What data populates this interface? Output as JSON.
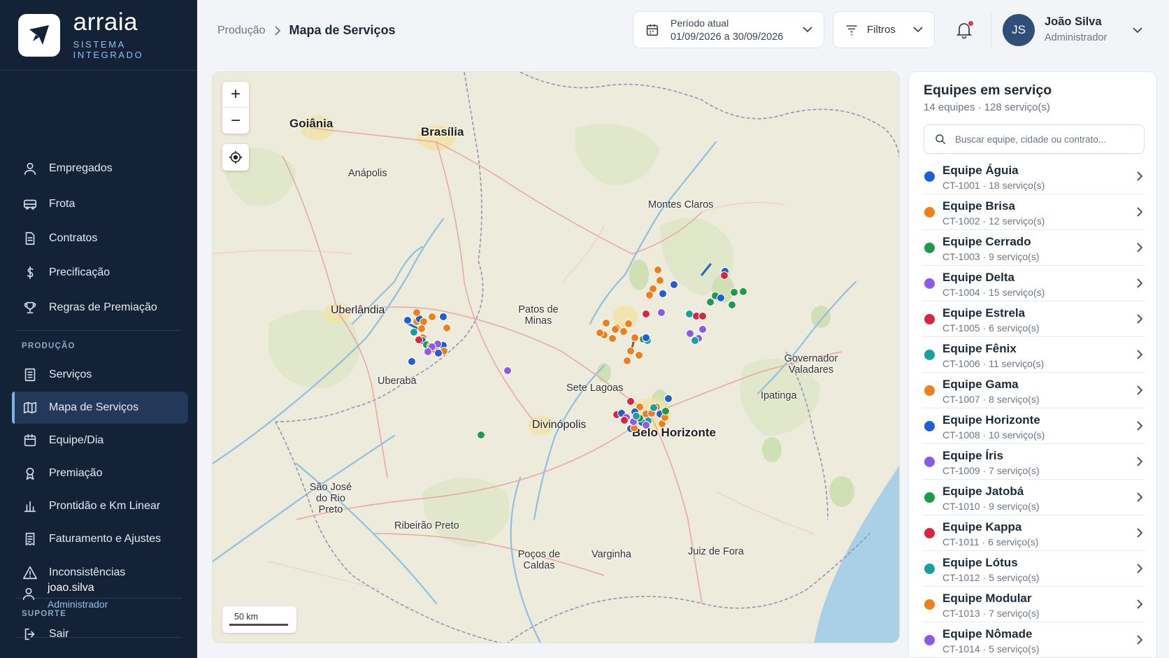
{
  "brand": {
    "name": "arraia",
    "subtitle": "SISTEMA INTEGRADO"
  },
  "sidebar": {
    "items": [
      {
        "label": "Empregados",
        "icon": "user-icon"
      },
      {
        "label": "Frota",
        "icon": "truck-icon"
      },
      {
        "label": "Contratos",
        "icon": "document-icon"
      },
      {
        "label": "Precificação",
        "icon": "dollar-icon"
      },
      {
        "label": "Regras de Premiação",
        "icon": "trophy-icon"
      }
    ],
    "producao_label": "PRODUÇÃO",
    "producao_items": [
      {
        "label": "Serviços",
        "icon": "list-icon"
      },
      {
        "label": "Mapa de Serviços",
        "icon": "map-icon",
        "active": true
      },
      {
        "label": "Equipe/Dia",
        "icon": "calendar-icon"
      },
      {
        "label": "Premiação",
        "icon": "award-icon"
      },
      {
        "label": "Prontidão e Km Linear",
        "icon": "bar-chart-icon"
      },
      {
        "label": "Faturamento e Ajustes",
        "icon": "receipt-icon"
      },
      {
        "label": "Inconsistências",
        "icon": "warning-icon"
      }
    ],
    "suporte_label": "SUPORTE",
    "user": {
      "name": "joao.silva",
      "role": "Administrador"
    },
    "logout_label": "Sair"
  },
  "header": {
    "breadcrumb_parent": "Produção",
    "breadcrumb_current": "Mapa de Serviços",
    "period_label": "Período atual",
    "period_value": "01/09/2026 a 30/09/2026",
    "filters_label": "Filtros",
    "user_initials": "JS",
    "user_name": "João Silva",
    "user_role": "Administrador"
  },
  "map": {
    "zoom_in": "+",
    "zoom_out": "−",
    "scale_label": "50 km",
    "cities": [
      {
        "name": "Goiânia",
        "big": true
      },
      {
        "name": "Brasília",
        "big": true
      },
      {
        "name": "Anápolis"
      },
      {
        "name": "Montes Claros"
      },
      {
        "name": "Uberlândia",
        "big": false
      },
      {
        "name": "Patos de Minas"
      },
      {
        "name": "Uberaba"
      },
      {
        "name": "Sete Lagoas"
      },
      {
        "name": "Governador Valadares"
      },
      {
        "name": "Ipatinga"
      },
      {
        "name": "Divinópolis"
      },
      {
        "name": "Belo Horizonte",
        "big": true
      },
      {
        "name": "São José do Rio Preto"
      },
      {
        "name": "Ribeirão Preto"
      },
      {
        "name": "Poços de Caldas"
      },
      {
        "name": "Varginha"
      },
      {
        "name": "Juiz de Fora"
      }
    ]
  },
  "panel": {
    "title": "Equipes em serviço",
    "subtitle": "14 equipes · 128 serviço(s)",
    "search_placeholder": "Buscar equipe, cidade ou contrato...",
    "teams": [
      {
        "name": "Equipe Águia",
        "meta": "CT-1001 · 18 serviço(s)",
        "color": "#1f5fd6"
      },
      {
        "name": "Equipe Brisa",
        "meta": "CT-1002 · 12 serviço(s)",
        "color": "#f07f1a"
      },
      {
        "name": "Equipe Cerrado",
        "meta": "CT-1003 · 9 serviço(s)",
        "color": "#1e9a4a"
      },
      {
        "name": "Equipe Delta",
        "meta": "CT-1004 · 15 serviço(s)",
        "color": "#8c5ae8"
      },
      {
        "name": "Equipe Estrela",
        "meta": "CT-1005 · 6 serviço(s)",
        "color": "#d9263f"
      },
      {
        "name": "Equipe Fênix",
        "meta": "CT-1006 · 11 serviço(s)",
        "color": "#16a0a0"
      },
      {
        "name": "Equipe Gama",
        "meta": "CT-1007 · 8 serviço(s)",
        "color": "#f07f1a"
      },
      {
        "name": "Equipe Horizonte",
        "meta": "CT-1008 · 10 serviço(s)",
        "color": "#1f5fd6"
      },
      {
        "name": "Equipe Íris",
        "meta": "CT-1009 · 7 serviço(s)",
        "color": "#8c5ae8"
      },
      {
        "name": "Equipe Jatobá",
        "meta": "CT-1010 · 9 serviço(s)",
        "color": "#1e9a4a"
      },
      {
        "name": "Equipe Kappa",
        "meta": "CT-1011 · 6 serviço(s)",
        "color": "#d9263f"
      },
      {
        "name": "Equipe Lótus",
        "meta": "CT-1012 · 5 serviço(s)",
        "color": "#16a0a0"
      },
      {
        "name": "Equipe Modular",
        "meta": "CT-1013 · 7 serviço(s)",
        "color": "#f07f1a"
      },
      {
        "name": "Equipe Nômade",
        "meta": "CT-1014 · 5 serviço(s)",
        "color": "#8c5ae8"
      }
    ]
  }
}
